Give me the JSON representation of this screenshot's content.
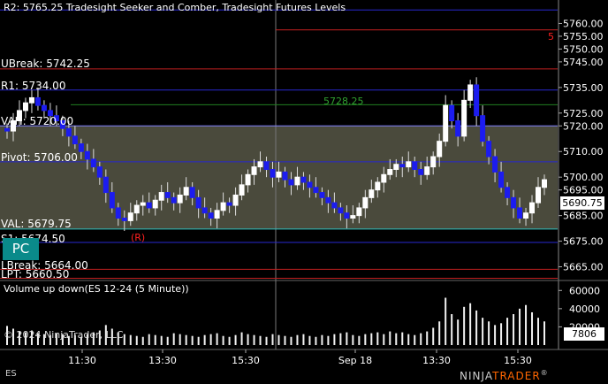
{
  "title": "R2: 5765.25 Tradesight Seeker and Comber, Tradesight Futures Levels",
  "volume_title": "Volume up down(ES 12-24 (5 Minute))",
  "copyright": "© 2024 NinjaTrader, LLC",
  "instrument": "ES",
  "logo": {
    "part1": "NINJA",
    "part2": "TRADER",
    "mark": "®"
  },
  "pc_badge": "PC",
  "last_price": "5690.75",
  "last_volume": "7806",
  "levels": [
    {
      "label": "R2: 5765.25",
      "price": 5765.25,
      "color": "#2828d0"
    },
    {
      "label": "UBreak: 5742.25",
      "price": 5742.25,
      "color": "#c02020"
    },
    {
      "label": "R1: 5734.00",
      "price": 5734.0,
      "color": "#2828d0"
    },
    {
      "label": "VAH: 5720.00",
      "price": 5720.0,
      "color": "#8080ff"
    },
    {
      "label": "Pivot: 5706.00",
      "price": 5706.0,
      "color": "#2828d0"
    },
    {
      "label": "VAL: 5679.75",
      "price": 5679.75,
      "color": "#30c0c0"
    },
    {
      "label": "S1: 5674.50",
      "price": 5674.5,
      "color": "#2828d0"
    },
    {
      "label": "LBreak: 5664.00",
      "price": 5664.0,
      "color": "#c02020"
    },
    {
      "label": "LPT: 5660.50",
      "price": 5660.5,
      "color": "#c02020"
    }
  ],
  "annotations": [
    {
      "text": "5728.25",
      "color": "#30a030"
    },
    {
      "text": "5",
      "color": "#ff2020"
    },
    {
      "text": "(R)",
      "color": "#ff2020"
    }
  ],
  "chart_data": {
    "type": "candlestick",
    "title": "Tradesight Seeker and Comber, Tradesight Futures Levels",
    "price_axis": {
      "ticks": [
        5760,
        5755,
        5750,
        5745,
        5735,
        5725,
        5720,
        5710,
        5700,
        5695,
        5685,
        5675,
        5665
      ],
      "range": [
        5660,
        5765
      ]
    },
    "time_axis": {
      "ticks": [
        "11:30",
        "13:30",
        "15:30",
        "Sep 18",
        "13:30",
        "15:30"
      ]
    },
    "volume_axis": {
      "ticks": [
        "60000",
        "40000",
        "20000"
      ],
      "range": [
        0,
        70000
      ]
    },
    "value_area": {
      "high": 5720.0,
      "low": 5679.75
    },
    "closes": [
      5718,
      5722,
      5726,
      5729,
      5731,
      5728,
      5726,
      5724,
      5722,
      5719,
      5716,
      5713,
      5710,
      5707,
      5704,
      5700,
      5694,
      5688,
      5684,
      5683,
      5686,
      5689,
      5690,
      5688,
      5691,
      5694,
      5692,
      5690,
      5693,
      5696,
      5692,
      5688,
      5686,
      5684,
      5687,
      5690,
      5689,
      5693,
      5697,
      5701,
      5704,
      5706,
      5703,
      5700,
      5702,
      5699,
      5697,
      5700,
      5698,
      5696,
      5694,
      5692,
      5690,
      5688,
      5686,
      5684,
      5685,
      5688,
      5692,
      5695,
      5698,
      5701,
      5703,
      5705,
      5704,
      5706,
      5703,
      5701,
      5704,
      5708,
      5714,
      5728,
      5722,
      5716,
      5730,
      5736,
      5724,
      5714,
      5708,
      5702,
      5696,
      5692,
      5688,
      5684,
      5686,
      5690,
      5696,
      5699
    ],
    "volumes": [
      21000,
      18000,
      15000,
      14000,
      16000,
      13000,
      12000,
      11000,
      13000,
      12000,
      10000,
      11000,
      9000,
      12000,
      14000,
      16000,
      22000,
      18000,
      14000,
      12000,
      11000,
      10000,
      9000,
      12000,
      11000,
      10000,
      9000,
      13000,
      12000,
      11000,
      10000,
      9000,
      11000,
      12000,
      13000,
      10000,
      9000,
      11000,
      14000,
      12000,
      11000,
      10000,
      9000,
      12000,
      11000,
      10000,
      9000,
      11000,
      12000,
      10000,
      9000,
      11000,
      10000,
      12000,
      13000,
      14000,
      11000,
      10000,
      12000,
      13000,
      14000,
      12000,
      15000,
      13000,
      14000,
      12000,
      11000,
      13000,
      15000,
      19000,
      26000,
      52000,
      34000,
      28000,
      42000,
      46000,
      38000,
      30000,
      26000,
      22000,
      24000,
      30000,
      34000,
      40000,
      44000,
      36000,
      30000,
      26000
    ]
  }
}
